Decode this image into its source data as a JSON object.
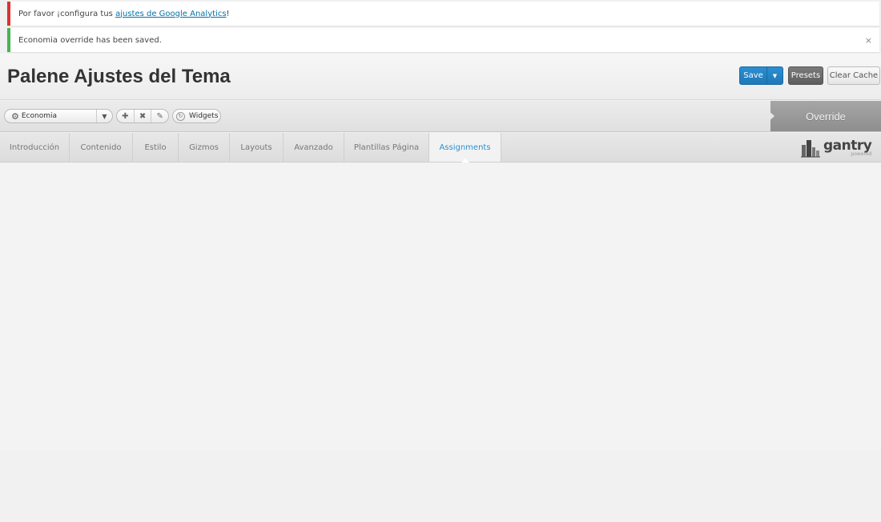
{
  "notices": {
    "analytics": {
      "prefix": "Por favor ¡configura tus ",
      "link": "ajustes de Google Analytics",
      "suffix": "!"
    },
    "saved": {
      "message": "Economia override has been saved.",
      "dismiss": "×"
    }
  },
  "header": {
    "title": "Palene Ajustes del Tema",
    "save_label": "Save",
    "presets_label": "Presets",
    "clear_cache_label": "Clear Cache"
  },
  "toolbar": {
    "override_selected": "Economia",
    "widgets_label": "Widgets",
    "override_tag": "Override",
    "icons": [
      "add-icon",
      "delete-icon",
      "edit-icon"
    ]
  },
  "tabs": [
    {
      "label": "Introducción"
    },
    {
      "label": "Contenido"
    },
    {
      "label": "Estilo"
    },
    {
      "label": "Gizmos"
    },
    {
      "label": "Layouts"
    },
    {
      "label": "Avanzado"
    },
    {
      "label": "Plantillas Página"
    },
    {
      "label": "Assignments",
      "active": true
    }
  ],
  "logo": {
    "name": "gantry",
    "tagline": "powered"
  },
  "colors": {
    "accent": "#2b8fd1",
    "error": "#dc3232",
    "success": "#46b450"
  }
}
